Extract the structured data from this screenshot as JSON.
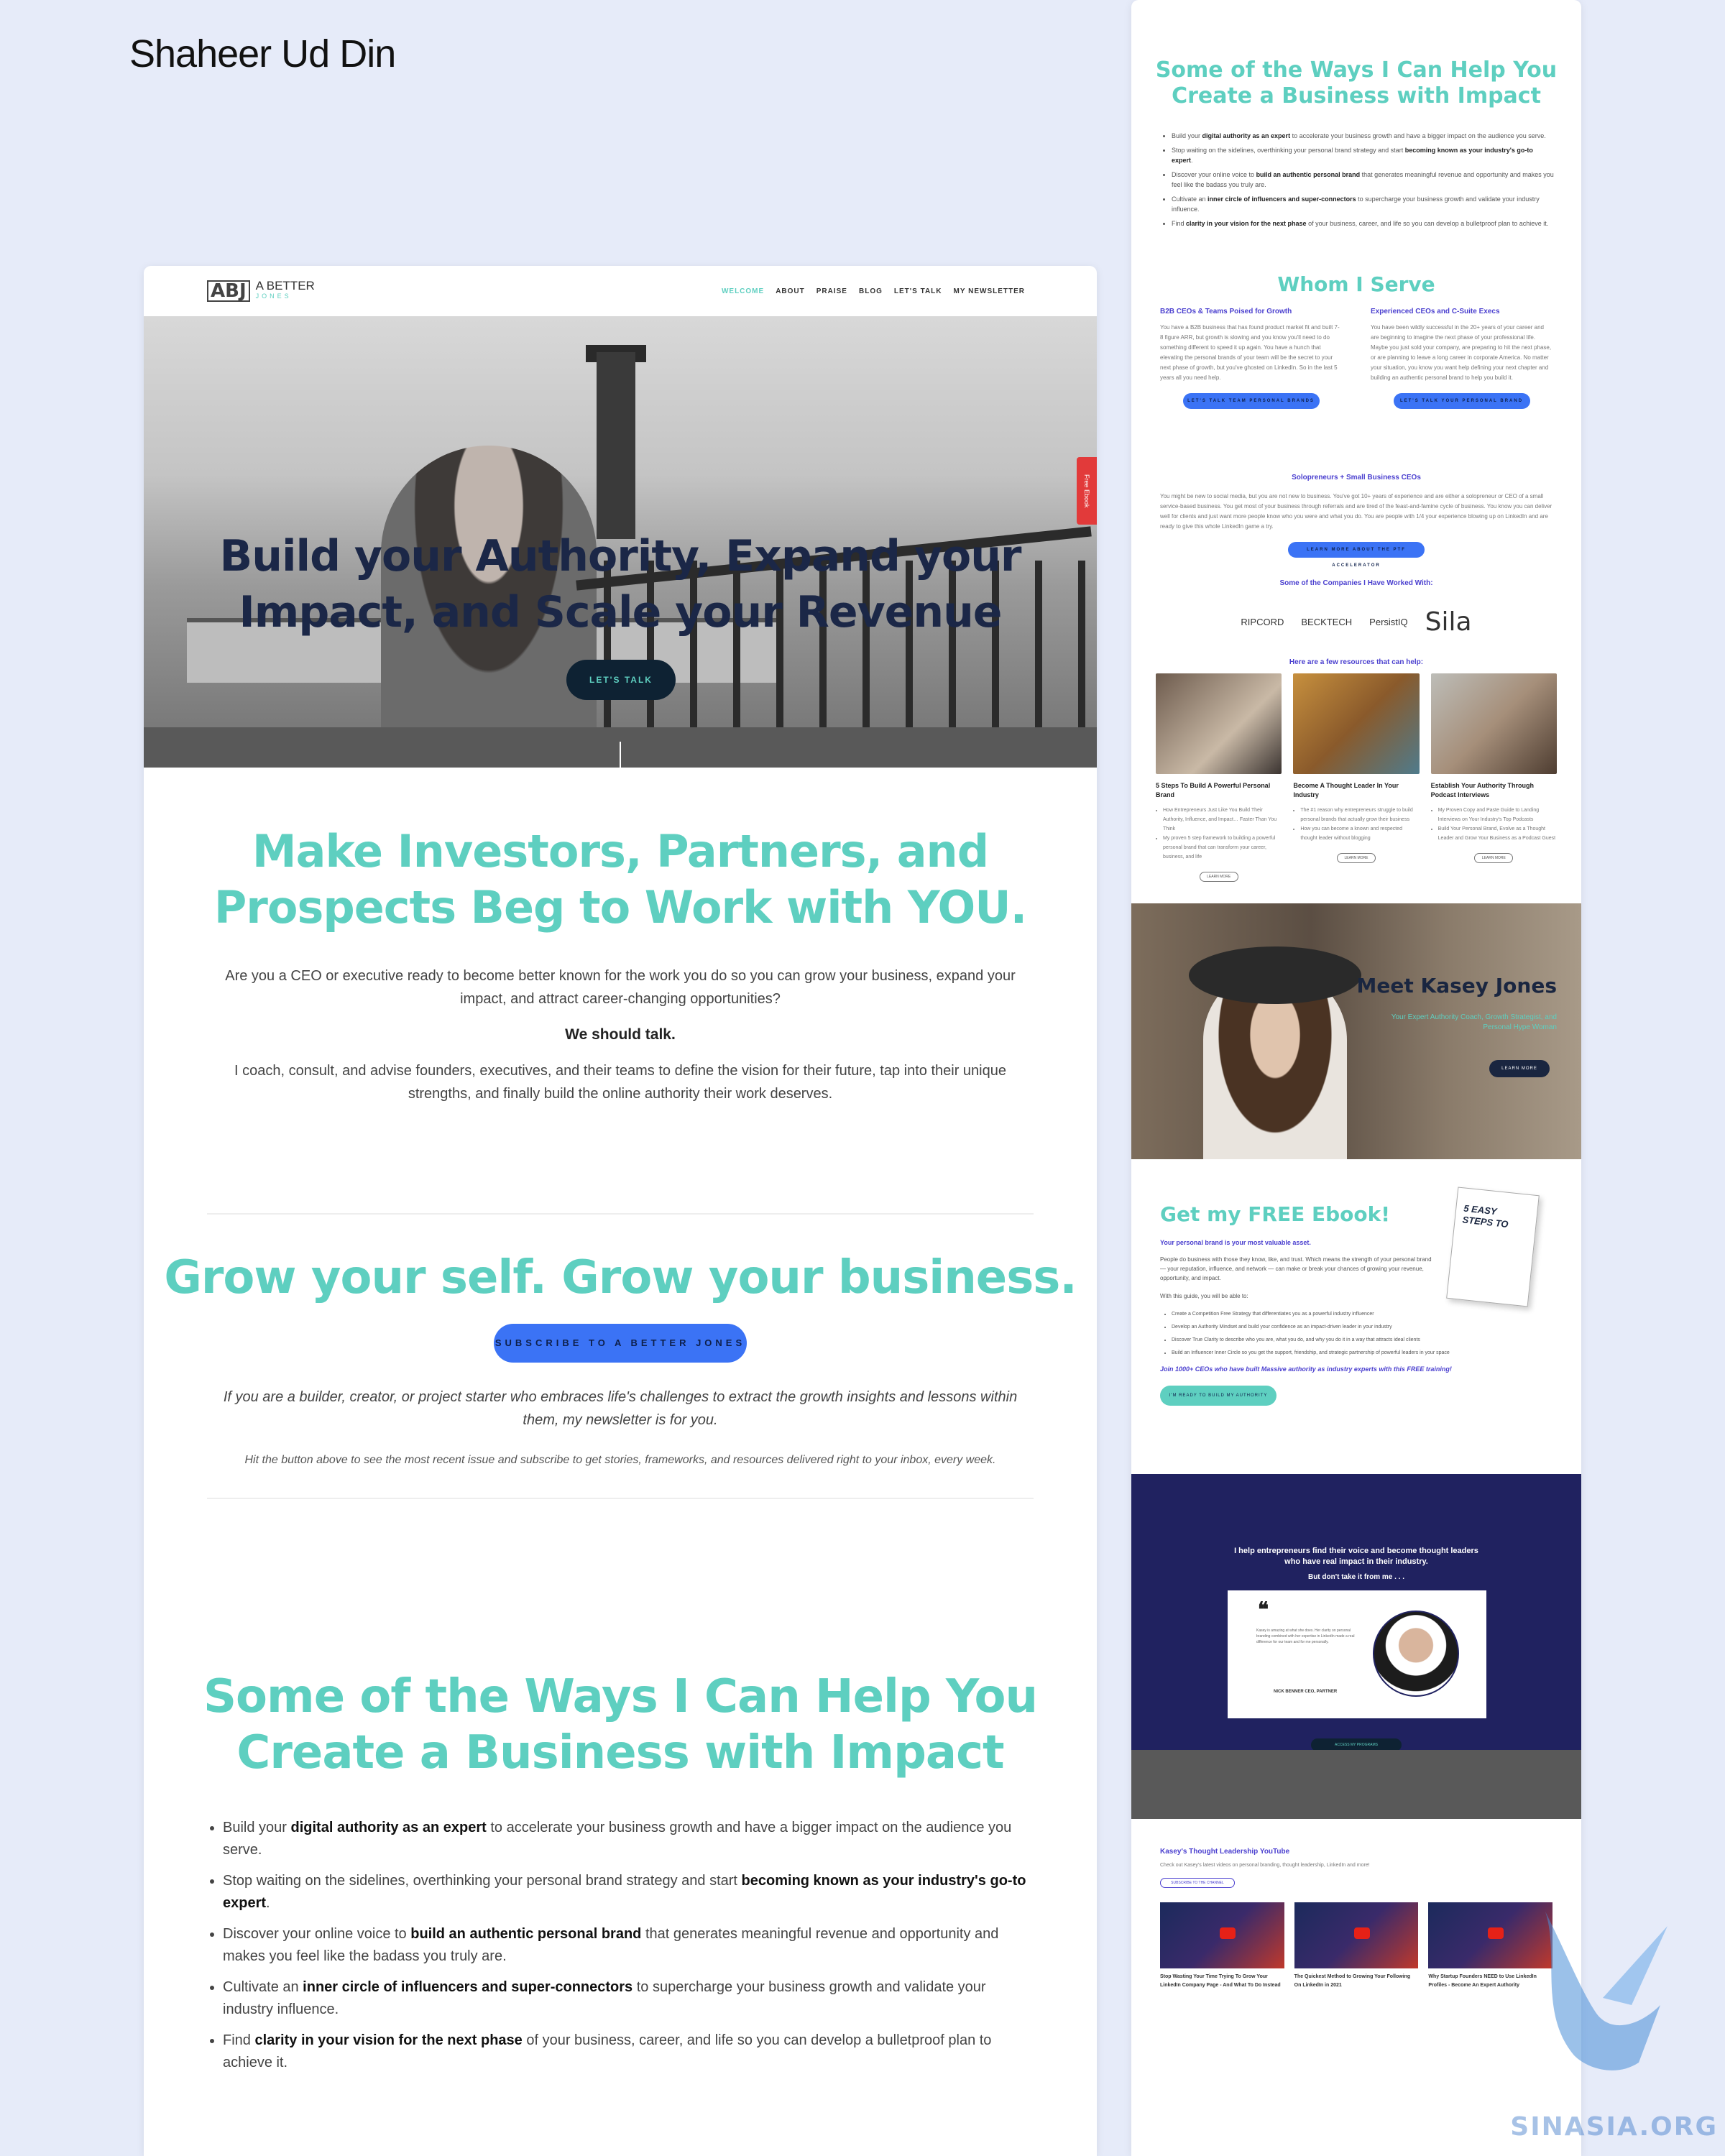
{
  "author": "Shaheer Ud Din",
  "site": {
    "logo_mark": "ABJ",
    "logo_line1": "A BETTER",
    "logo_line2": "JONES",
    "nav": [
      "WELCOME",
      "ABOUT",
      "PRAISE",
      "BLOG",
      "LET'S TALK",
      "MY NEWSLETTER"
    ],
    "side_tab": "Free Ebook"
  },
  "hero": {
    "title_line1": "Build your Authority, Expand your",
    "title_line2": "Impact, and Scale your Revenue",
    "cta": "LET'S TALK"
  },
  "section1": {
    "heading_line1": "Make Investors, Partners, and",
    "heading_line2": "Prospects Beg to Work with YOU.",
    "para1": "Are you a CEO or executive ready to become better known for the work you do so you can grow your business, expand your impact, and attract career-changing opportunities?",
    "bold": "We should talk.",
    "para2": "I coach, consult, and advise founders, executives, and their teams to define the vision for their future, tap into their unique strengths, and finally build the online authority their work deserves."
  },
  "section2": {
    "heading": "Grow your self. Grow your business.",
    "button": "SUBSCRIBE TO A BETTER JONES",
    "para1": "If you are a builder, creator, or project starter who embraces life's challenges to extract the growth insights and lessons within them, my newsletter is for you.",
    "para2": "Hit the button above to see the most recent issue and subscribe to get stories, frameworks, and resources delivered right to your inbox, every week."
  },
  "section3": {
    "heading_line1": "Some of the Ways I Can Help You",
    "heading_line2": "Create a  Business with Impact",
    "bullets": [
      {
        "pre": "Build your ",
        "bold": "digital authority as an expert",
        "post": " to accelerate your business growth and have a bigger impact on the audience you serve."
      },
      {
        "pre": "Stop waiting on the sidelines, overthinking your personal brand strategy and start ",
        "bold": "becoming known as your industry's go-to expert",
        "post": "."
      },
      {
        "pre": "Discover your online voice to ",
        "bold": "build an authentic personal brand",
        "post": " that generates meaningful revenue and opportunity and makes you feel like the badass you truly are."
      },
      {
        "pre": "Cultivate an ",
        "bold": "inner circle of influencers and super-connectors",
        "post": " to supercharge your business growth and validate your industry influence."
      },
      {
        "pre": "Find ",
        "bold": "clarity in your vision for the next phase",
        "post": " of your business, career, and life so you can develop a bulletproof plan to achieve it."
      }
    ]
  },
  "right": {
    "heading1_line1": "Some of the Ways I Can Help You",
    "heading1_line2": "Create a  Business with Impact",
    "whom": "Whom I Serve",
    "col1_title": "B2B CEOs & Teams Poised for Growth",
    "col1_text": "You have a B2B business that has found product market fit and built 7-8 figure ARR, but growth is slowing and you know you'll need to do something different to speed it up again. You have a hunch that elevating the personal brands of your team will be the secret to your next phase of growth, but you've ghosted on LinkedIn. So in the last 5 years all you need help.",
    "col1_btn": "LET'S TALK TEAM PERSONAL BRANDS",
    "col2_title": "Experienced CEOs and C-Suite Execs",
    "col2_text": "You have been wildly successful in the 20+ years of your career and are beginning to imagine the next phase of your professional life. Maybe you just sold your company, are preparing to hit the next phase, or are planning to leave a long career in corporate America. No matter your situation, you know you want help defining your next chapter and building an authentic personal brand to help you build it.",
    "col2_btn": "LET'S TALK YOUR PERSONAL BRAND",
    "solo_title": "Solopreneurs + Small Business CEOs",
    "solo_text": "You might be new to social media, but you are not new to business. You've got 10+ years of experience and are either a solopreneur or CEO of a small service-based business. You get most of your business through referrals and are tired of the feast-and-famine cycle of business. You know you can deliver well for clients and just want more people know who you were and what you do. You are people with 1/4 your experience blowing up on LinkedIn and are ready to give this whole LinkedIn game a try.",
    "solo_btn": "LEARN MORE ABOUT THE PTF ACCELERATOR",
    "companies_head": "Some of the Companies I Have Worked With:",
    "companies": [
      "RIPCORD",
      "BECKTECH",
      "PersistIQ",
      "Sila"
    ],
    "resources_head": "Here are a few resources that can help:",
    "resources": [
      {
        "title": "5 Steps To Build A Powerful Personal Brand",
        "b1": "How Entrepreneurs Just Like You Build Their Authority, Influence, and Impact… Faster Than You Think",
        "b2": "My proven 5 step framework to building a powerful personal brand that can transform your career, business, and life",
        "btn": "LEARN MORE"
      },
      {
        "title": "Become A Thought Leader In Your Industry",
        "b1": "The #1 reason why entrepreneurs struggle to build personal brands that actually grow their business",
        "b2": "How you can become a known and respected thought leader without blogging",
        "btn": "LEARN MORE"
      },
      {
        "title": "Establish Your Authority Through Podcast Interviews",
        "b1": "My Proven Copy and Paste Guide to Landing Interviews on Your Industry's Top Podcasts",
        "b2": "Build Your Personal Brand, Evolve as a Thought Leader and Grow Your Business as a Podcast Guest",
        "btn": "LEARN MORE"
      }
    ],
    "meet_title": "Meet Kasey Jones",
    "meet_sub": "Your Expert Authority Coach, Growth Strategist, and Personal Hype Woman",
    "meet_btn": "LEARN MORE",
    "ebook_title": "Get my FREE Ebook!",
    "ebook_bold": "Your personal brand is your most valuable asset.",
    "ebook_para": "People do business with those they know, like, and trust. Which means the strength of your personal brand — your reputation, influence, and network — can make or break your chances of growing your revenue, opportunity, and impact.",
    "ebook_with": "With this guide, you will be able to:",
    "ebook_list": [
      "Create a Competition Free Strategy that differentiates you as a powerful industry influencer",
      "Develop an Authority Mindset and build your confidence as an impact-driven leader in your industry",
      "Discover True Clarity to describe who you are, what you do, and why you do it in a way that attracts ideal clients",
      "Build an Influencer Inner Circle so you get the support, friendship, and strategic partnership of powerful leaders in your space"
    ],
    "ebook_join": "Join 1000+ CEOs who have built Massive authority as industry experts with this FREE training!",
    "ebook_btn": "I'M READY TO BUILD MY AUTHORITY",
    "book_title": "5 EASY STEPS TO",
    "testi_line1": "I help entrepreneurs find their voice and become thought leaders",
    "testi_line2": "who have real impact in their industry.",
    "testi_sub": "But don't take it from me . . .",
    "testi_quote": "Kasey is amazing at what she does. Her clarity on personal branding combined with her expertise in LinkedIn made a real difference for our team and for me personally.",
    "testi_name": "NICK BENNER  CEO, PARTNER",
    "testi_btn": "ACCESS MY PROGRAMS",
    "yt_title": "Kasey's Thought Leadership YouTube",
    "yt_sub": "Check out Kasey's latest videos on personal branding, thought leadership, LinkedIn and more!",
    "yt_btn": "SUBSCRIBE TO THE CHANNEL",
    "videos": [
      "Stop Wasting Your Time Trying To Grow Your LinkedIn Company Page - And What To Do Instead",
      "The Quickest Method to Growing Your Following On LinkedIn in 2021",
      "Why Startup Founders NEED to Use LinkedIn Profiles - Become An Expert Authority"
    ]
  },
  "watermark": "SINASIA.ORG"
}
